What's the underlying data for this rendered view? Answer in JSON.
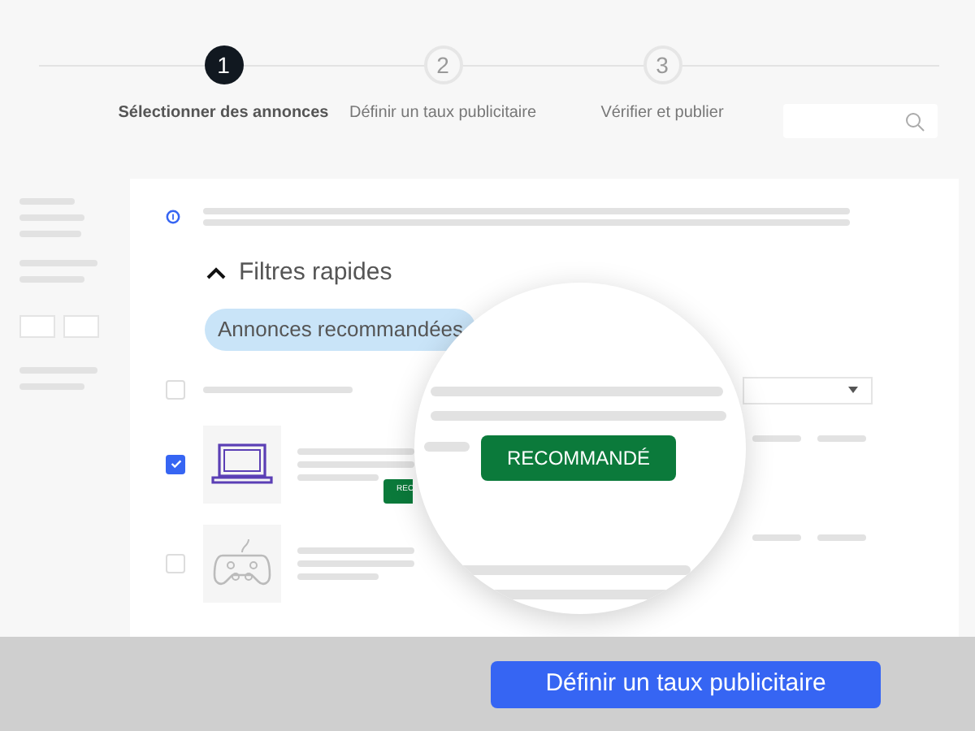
{
  "stepper": {
    "steps": [
      {
        "number": "1",
        "label": "Sélectionner des annonces",
        "selected": true
      },
      {
        "number": "2",
        "label": "Définir un taux publicitaire",
        "selected": false
      },
      {
        "number": "3",
        "label": "Vérifier et publier",
        "selected": false
      }
    ]
  },
  "filters": {
    "title": "Filtres rapides",
    "expanded": true,
    "chips": [
      {
        "label": "Annonces recommandées",
        "selected": true
      }
    ]
  },
  "select_all": {
    "checked": false
  },
  "listings": [
    {
      "kind": "laptop",
      "checked": true,
      "badge": "REC"
    },
    {
      "kind": "gamepad",
      "checked": false
    }
  ],
  "magnifier": {
    "badge": "RECOMMANDÉ"
  },
  "footer": {
    "button": "Définir un taux publicitaire"
  }
}
